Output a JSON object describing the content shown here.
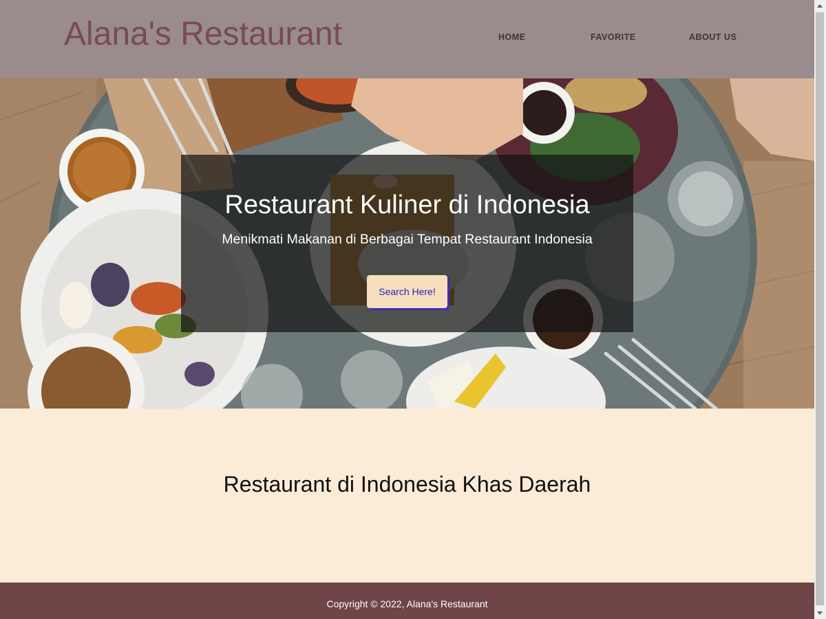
{
  "header": {
    "brand": "Alana's Restaurant",
    "nav": {
      "home": "HOME",
      "favorite": "FAVORITE",
      "about": "ABOUT US"
    }
  },
  "hero": {
    "title": "Restaurant Kuliner di Indonesia",
    "subtitle": "Menikmati Makanan di Berbagai Tempat Restaurant Indonesia",
    "button": "Search Here!",
    "image": "food-table-photo"
  },
  "section": {
    "title": "Restaurant di Indonesia Khas Daerah"
  },
  "footer": {
    "copyright": "Copyright © 2022, Alana's Restaurant"
  },
  "colors": {
    "header_bg": "#9a8b8c",
    "brand": "#7a4a54",
    "section_bg": "#fbebd7",
    "footer_bg": "#6f4547",
    "button_bg": "#f7dfbd",
    "button_text": "#2020c0"
  }
}
